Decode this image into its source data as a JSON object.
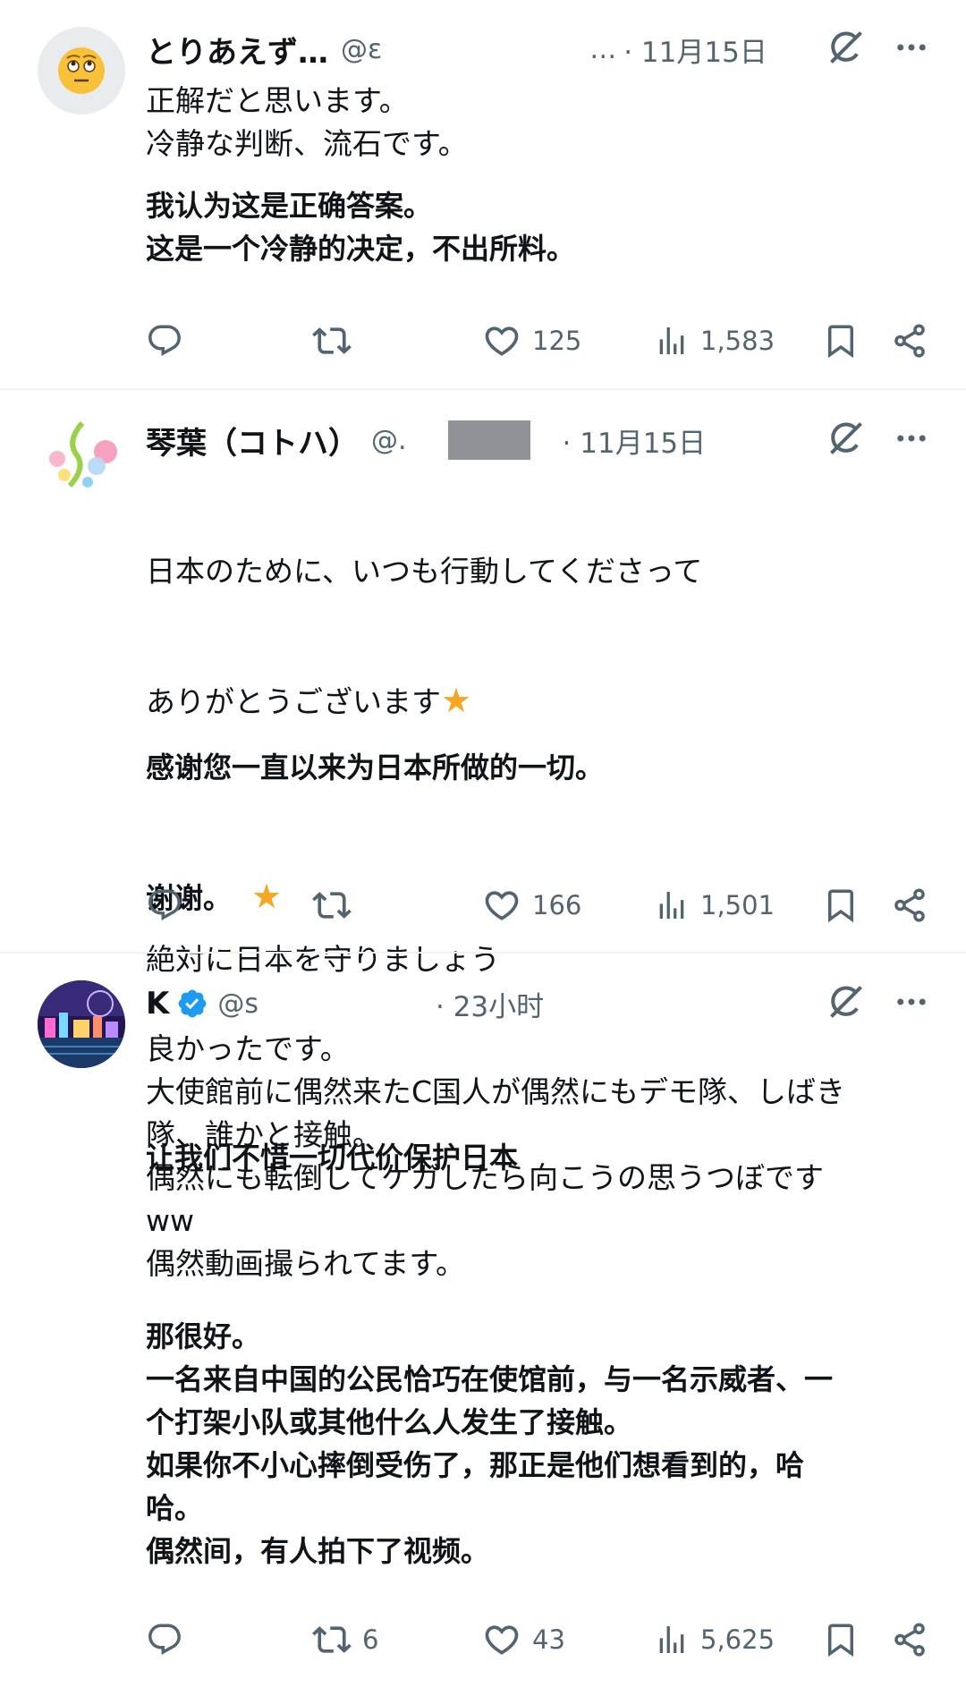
{
  "tweets": [
    {
      "name": "とりあえず…",
      "handle": "@ε",
      "handle_tail": "…",
      "time": "· 11月15日",
      "text": "正解だと思います。\n冷静な判断、流石です。",
      "translation": "我认为这是正确答案。\n这是一个冷静的决定，不出所料。",
      "actions": {
        "reply": "",
        "retweet": "",
        "like": "125",
        "views": "1,583"
      }
    },
    {
      "name": "琴葉（コトハ）",
      "handle": "@.",
      "time": "· 11月15日",
      "text_line1": "日本のために、いつも行動してくださって",
      "text_line2": "ありがとうございます",
      "text_line3": "絶対に日本を守りましょう",
      "translation_line1": "感谢您一直以来为日本所做的一切。",
      "translation_line2": "谢谢。",
      "translation_line3": "让我们不惜一切代价保护日本",
      "star": "★",
      "actions": {
        "reply": "",
        "retweet": "",
        "like": "166",
        "views": "1,501"
      }
    },
    {
      "name": "K",
      "handle": "@s",
      "handle_tail": "",
      "time": "· 23小时",
      "text": "良かったです。\n大使館前に偶然来たC国人が偶然にもデモ隊、しばき\n隊、誰かと接触。\n偶然にも転倒してケガしたら向こうの思うつぼです\nww\n偶然動画撮られてます。",
      "translation": "那很好。\n一名来自中国的公民恰巧在使馆前，与一名示威者、一\n个打架小队或其他什么人发生了接触。\n如果你不小心摔倒受伤了，那正是他们想看到的，哈\n哈。\n偶然间，有人拍下了视频。",
      "actions": {
        "reply": "",
        "retweet": "6",
        "like": "43",
        "views": "5,625"
      }
    }
  ],
  "colors": {
    "accent": "#1d9bf0",
    "muted": "#536471",
    "text": "#0f1419",
    "star": "#f5a623"
  },
  "icons": [
    "reply-icon",
    "retweet-icon",
    "like-icon",
    "views-icon",
    "bookmark-icon",
    "share-icon",
    "grok-icon",
    "more-icon",
    "verified-icon"
  ]
}
